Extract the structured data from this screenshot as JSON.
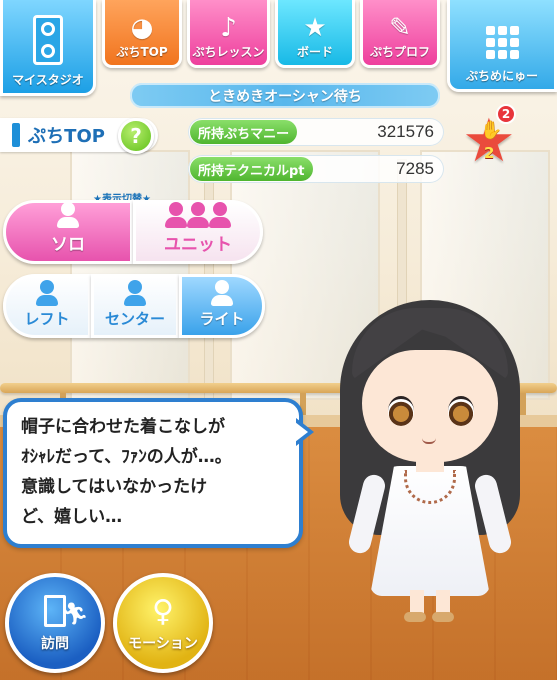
{
  "top_nav": {
    "studio": {
      "label": "マイスタジオ",
      "icon": "speaker-icon"
    },
    "top": {
      "label": "ぷちTOP",
      "icon": "bird-icon"
    },
    "lesson": {
      "label": "ぷちレッスン",
      "icon": "music-note-icon"
    },
    "board": {
      "label": "ボード",
      "icon": "star-icon"
    },
    "profile": {
      "label": "ぷちプロフ",
      "icon": "notepad-icon"
    },
    "menu": {
      "label": "ぷちめにゅー",
      "icon": "grid-icon"
    }
  },
  "status_banner": "ときめきオーシャン待ち",
  "page_title": "ぷちTOP",
  "help_label": "?",
  "currency": {
    "money_label": "所持ぷちマニー",
    "money_value": "321576",
    "technical_label": "所持テクニカルpt",
    "technical_value": "7285"
  },
  "like": {
    "count": "2",
    "badge": "2",
    "icon": "thumbs-up-star-icon"
  },
  "display_switch": {
    "title": "★表示切替★",
    "modes": [
      {
        "label": "ソロ",
        "selected": true
      },
      {
        "label": "ユニット",
        "selected": false
      }
    ],
    "lighting": [
      {
        "label": "レフト",
        "selected": false
      },
      {
        "label": "センター",
        "selected": false
      },
      {
        "label": "ライト",
        "selected": true
      }
    ]
  },
  "speech": {
    "lines": [
      "帽子に合わせた着こなしが",
      "ｵｼｬﾚだって、ﾌｧﾝの人が…。",
      "意識してはいなかったけ",
      "ど、嬉しい…"
    ]
  },
  "bottom_actions": {
    "visit": {
      "label": "訪問",
      "icon": "door-runner-icon"
    },
    "motion": {
      "label": "モーション",
      "icon": "dancer-icon"
    }
  },
  "colors": {
    "accent_blue": "#1e8fd8",
    "pink": "#e753ad",
    "orange": "#f1741e",
    "green": "#4fb52f",
    "star_red": "#ea4b3c"
  }
}
